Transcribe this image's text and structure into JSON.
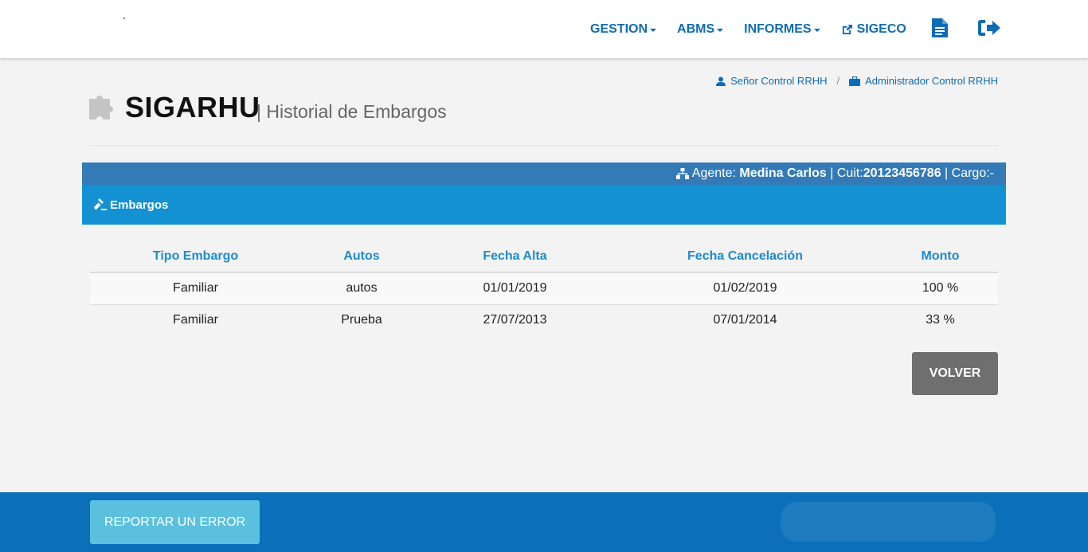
{
  "nav": {
    "gestion": "GESTION",
    "abms": "ABMS",
    "informes": "INFORMES",
    "sigeco": "SIGECO"
  },
  "breadcrumb": {
    "user": "Señor Control RRHH",
    "separator": "/",
    "role": "Administrador Control RRHH"
  },
  "header": {
    "title": "SIGARHU",
    "subtitle": "| Historial de Embargos"
  },
  "agent": {
    "label": "Agente:",
    "name": "Medina Carlos",
    "cuit_label": "| Cuit:",
    "cuit": "20123456786",
    "cargo_label": "| Cargo:-"
  },
  "panel": {
    "title": "Embargos"
  },
  "table": {
    "headers": [
      "Tipo Embargo",
      "Autos",
      "Fecha Alta",
      "Fecha Cancelación",
      "Monto"
    ],
    "rows": [
      [
        "Familiar",
        "autos",
        "01/01/2019",
        "01/02/2019",
        "100 %"
      ],
      [
        "Familiar",
        "Prueba",
        "27/07/2013",
        "07/01/2014",
        "33 %"
      ]
    ]
  },
  "buttons": {
    "volver": "VOLVER",
    "report": "REPORTAR UN ERROR"
  },
  "colors": {
    "primary": "#0d6cb5",
    "agent_bar": "#337ab7",
    "panel_head": "#1391d2",
    "footer": "#0b70b9",
    "report_button": "#5bc0de",
    "volver_button": "#6f6f6f"
  }
}
